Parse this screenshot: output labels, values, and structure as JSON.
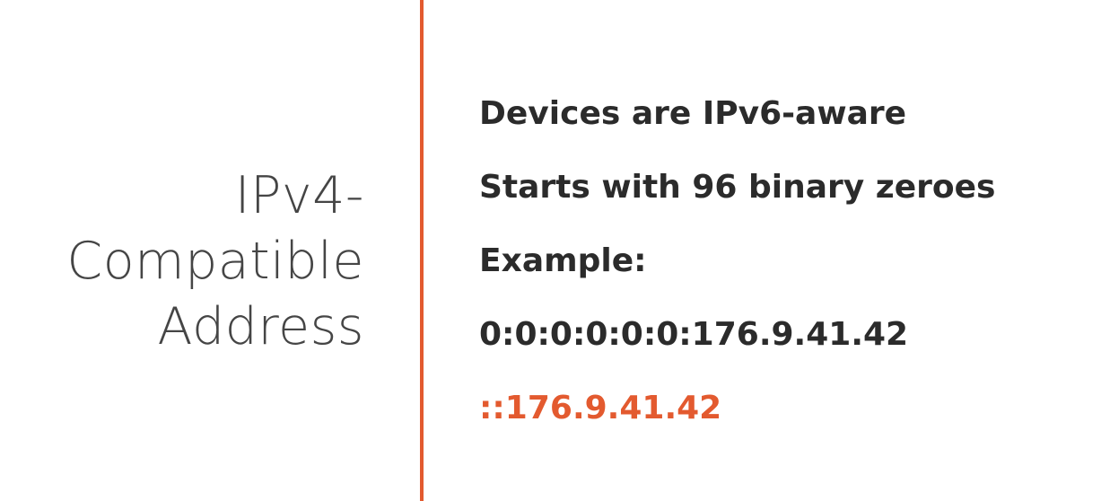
{
  "title": {
    "lines": [
      "IPv4-",
      "Compatible",
      "Address"
    ]
  },
  "bullets": {
    "line1": "Devices are IPv6-aware",
    "line2": "Starts with 96 binary zeroes",
    "line3": "Example:",
    "line4": "0:0:0:0:0:0:176.9.41.42",
    "line5": "::176.9.41.42"
  },
  "colors": {
    "accent": "#e35a2f",
    "title_text": "#454545",
    "body_text": "#2b2b2b",
    "background": "#ffffff"
  }
}
